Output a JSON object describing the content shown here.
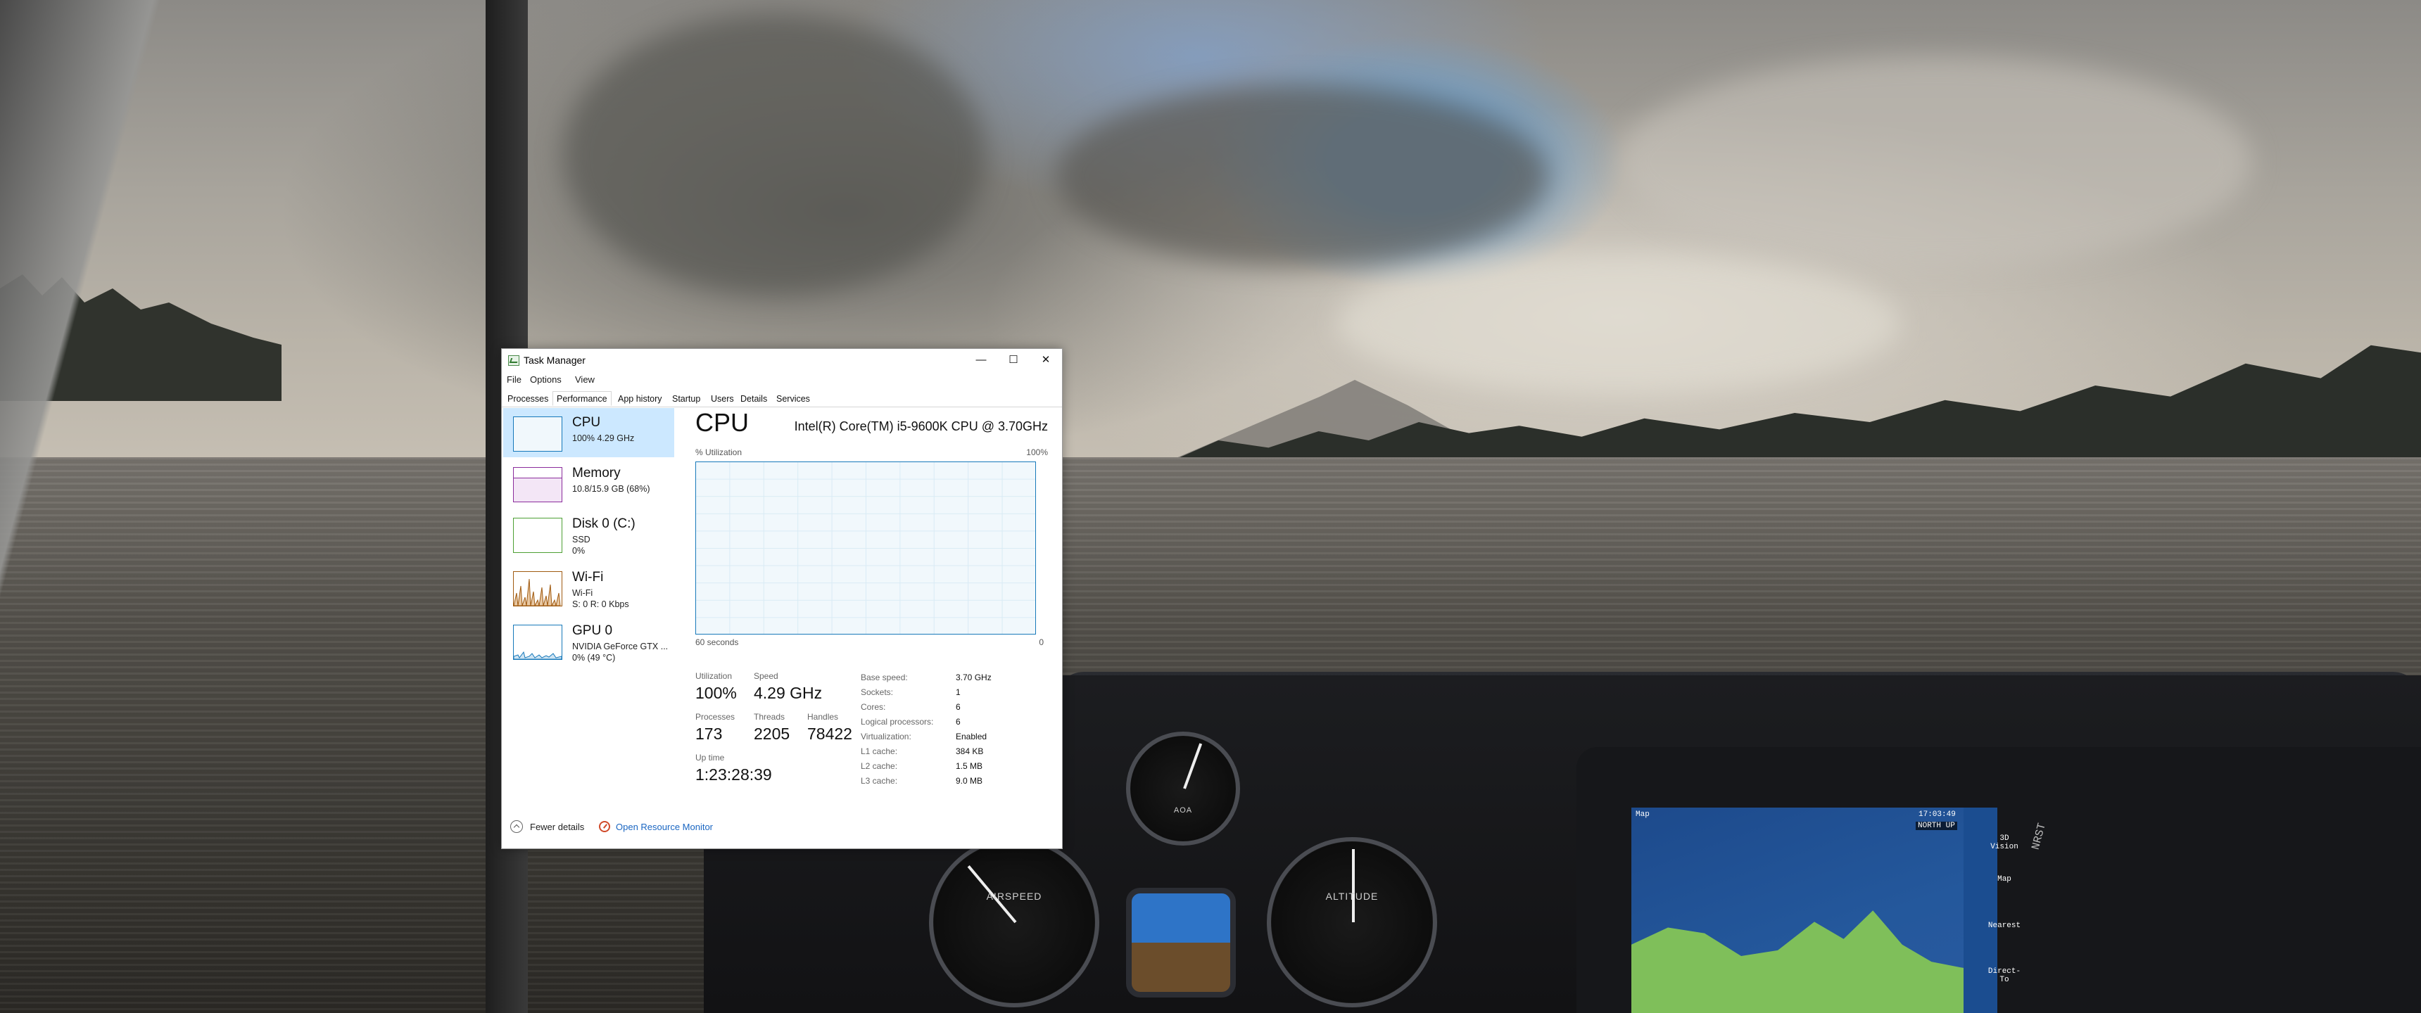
{
  "window": {
    "title": "Task Manager",
    "minimize": "—",
    "maximize": "☐",
    "close": "✕"
  },
  "menu": [
    "File",
    "Options",
    "View"
  ],
  "tabs": [
    "Processes",
    "Performance",
    "App history",
    "Startup",
    "Users",
    "Details",
    "Services"
  ],
  "sidebar": {
    "cpu": {
      "name": "CPU",
      "line1": "100%  4.29 GHz"
    },
    "memory": {
      "name": "Memory",
      "line1": "10.8/15.9 GB (68%)"
    },
    "disk": {
      "name": "Disk 0 (C:)",
      "line1": "SSD",
      "line2": "0%"
    },
    "wifi": {
      "name": "Wi-Fi",
      "line1": "Wi-Fi",
      "line2": "S: 0  R: 0 Kbps"
    },
    "gpu": {
      "name": "GPU 0",
      "line1": "NVIDIA GeForce GTX ...",
      "line2": "0%  (49 °C)"
    }
  },
  "cpu": {
    "title": "CPU",
    "model": "Intel(R) Core(TM) i5-9600K CPU @ 3.70GHz",
    "util_label": "% Utilization",
    "util_max": "100%",
    "time_label": "60 seconds",
    "time_min": "0",
    "utilization_label": "Utilization",
    "utilization": "100%",
    "speed_label": "Speed",
    "speed": "4.29 GHz",
    "processes_label": "Processes",
    "processes": "173",
    "threads_label": "Threads",
    "threads": "2205",
    "handles_label": "Handles",
    "handles": "78422",
    "uptime_label": "Up time",
    "uptime": "1:23:28:39",
    "specs": [
      {
        "label": "Base speed:",
        "value": "3.70 GHz"
      },
      {
        "label": "Sockets:",
        "value": "1"
      },
      {
        "label": "Cores:",
        "value": "6"
      },
      {
        "label": "Logical processors:",
        "value": "6"
      },
      {
        "label": "Virtualization:",
        "value": "Enabled"
      },
      {
        "label": "L1 cache:",
        "value": "384 KB"
      },
      {
        "label": "L2 cache:",
        "value": "1.5 MB"
      },
      {
        "label": "L3 cache:",
        "value": "9.0 MB"
      }
    ]
  },
  "footer": {
    "fewer_details": "Fewer details",
    "resource_monitor": "Open Resource Monitor"
  },
  "cockpit": {
    "airspeed_label": "AIRSPEED",
    "altitude_label": "ALTITUDE",
    "aoa_label": "AOA",
    "mfd_title": "Map",
    "mfd_time": "17:03:49",
    "mfd_orient": "NORTH UP",
    "mfd_buttons": [
      "3D Vision",
      "Map",
      "Nearest",
      "Direct-To"
    ],
    "mfd_side": "NRST"
  },
  "colors": {
    "accent": "#1779ba",
    "selected": "#cce8ff",
    "memory": "#8b2c9c",
    "disk": "#4da033",
    "wifi": "#a05a10",
    "gpu": "#1779ba"
  }
}
